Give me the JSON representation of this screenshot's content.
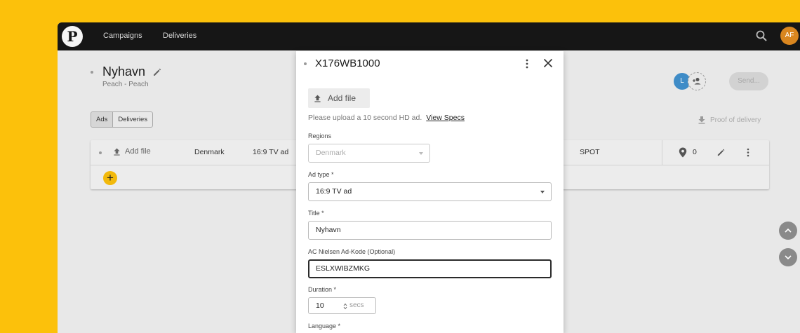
{
  "topbar": {
    "logo": "P",
    "nav": [
      "Campaigns",
      "Deliveries"
    ],
    "user_initials": "AF"
  },
  "campaign": {
    "title": "Nyhavn",
    "subtitle": "Peach - Peach",
    "segments": [
      "Ads",
      "Deliveries"
    ],
    "share_initial": "L",
    "send_label": "Send...",
    "proof_label": "Proof of delivery"
  },
  "ad_row": {
    "add_file": "Add file",
    "region": "Denmark",
    "ad_type": "16:9 TV ad",
    "format": "SPOT",
    "location_count": "0",
    "add_row": "+"
  },
  "modal": {
    "title": "X176WB1000",
    "add_file": "Add file",
    "hint": "Please upload a 10 second HD ad.",
    "hint_link": "View Specs",
    "regions_label": "Regions",
    "regions_value": "Denmark",
    "adtype_label": "Ad type *",
    "adtype_value": "16:9 TV ad",
    "title_label": "Title *",
    "title_value": "Nyhavn",
    "nielsen_label": "AC Nielsen Ad-Kode (Optional)",
    "nielsen_value": "ESLXWIBZMKG",
    "duration_label": "Duration *",
    "duration_value": "10",
    "duration_unit": "secs",
    "language_label": "Language *"
  },
  "colors": {
    "background": "#fcc10b",
    "topbar": "#161616",
    "accent": "#f2b90b",
    "avatar_af": "#d9861f",
    "avatar_l": "#3f8cc7"
  }
}
